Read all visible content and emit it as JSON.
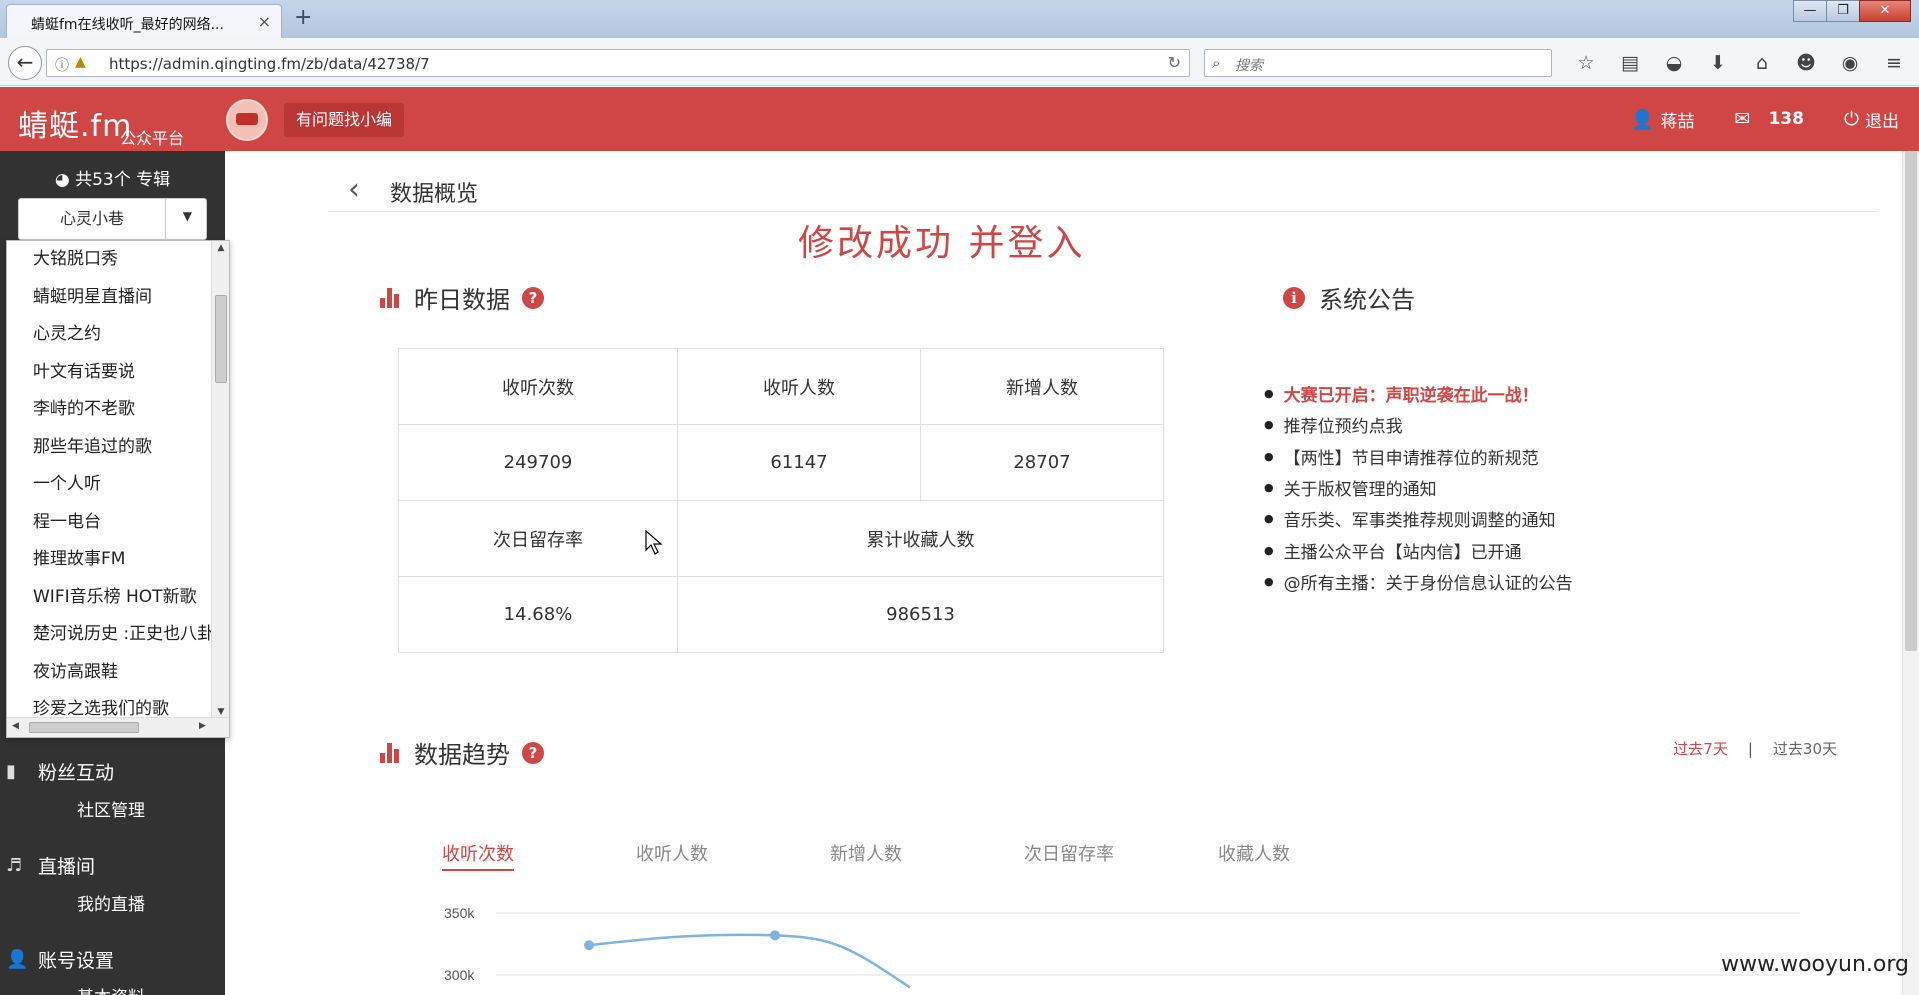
{
  "browser": {
    "tab_title": "蜻蜓fm在线收听_最好的网络...",
    "tab_close": "×",
    "new_tab": "+",
    "window_buttons": [
      "—",
      "❐",
      "✕"
    ],
    "url": "https://admin.qingting.fm/zb/data/42738/7",
    "search_placeholder": "搜索",
    "toolbar_icons": [
      "star-icon",
      "reading-list-icon",
      "pocket-icon",
      "download-icon",
      "home-icon",
      "chat-icon",
      "profile-icon",
      "menu-icon"
    ]
  },
  "header": {
    "logo": "蜻蜓.fm",
    "logo_sub": "公众平台",
    "helper_button": "有问题找小编",
    "user_name": "蒋喆",
    "message_count": "138",
    "logout": "退出",
    "brand_color": "#d04644"
  },
  "sidebar": {
    "album_count": "共53个 专辑",
    "album_selected": "心灵小巷",
    "album_options": [
      "大铭脱口秀",
      "蜻蜓明星直播间",
      "心灵之约",
      "叶文有话要说",
      "李峙的不老歌",
      "那些年追过的歌",
      "一个人听",
      "程一电台",
      "推理故事FM",
      "WIFI音乐榜 HOT新歌",
      "楚河说历史 :正史也八卦",
      "夜访高跟鞋",
      "珍爱之选我们的歌"
    ],
    "sections": [
      {
        "label": "粉丝互动",
        "icon": "comment-icon",
        "sub": "社区管理"
      },
      {
        "label": "直播间",
        "icon": "headphones-icon",
        "sub": "我的直播"
      },
      {
        "label": "账号设置",
        "icon": "user-icon",
        "sub": "基本资料"
      }
    ]
  },
  "main": {
    "page_title": "数据概览",
    "success_message": "修改成功  并登入",
    "yesterday": {
      "title": "昨日数据",
      "headers_row1": [
        "收听次数",
        "收听人数",
        "新增人数"
      ],
      "values_row1": [
        "249709",
        "61147",
        "28707"
      ],
      "headers_row2": [
        "次日留存率",
        "累计收藏人数"
      ],
      "values_row2": [
        "14.68%",
        "986513"
      ]
    },
    "announcements": {
      "title": "系统公告",
      "items": [
        {
          "text": "大赛已开启：声职逆袭在此一战！",
          "hot": true
        },
        {
          "text": "推荐位预约点我",
          "hot": false
        },
        {
          "text": "【两性】节目申请推荐位的新规范",
          "hot": false
        },
        {
          "text": "关于版权管理的通知",
          "hot": false
        },
        {
          "text": "音乐类、军事类推荐规则调整的通知",
          "hot": false
        },
        {
          "text": "主播公众平台【站内信】已开通",
          "hot": false
        },
        {
          "text": "@所有主播：关于身份信息认证的公告",
          "hot": false
        }
      ]
    },
    "trend": {
      "title": "数据趋势",
      "range_active": "过去7天",
      "range_separator": "|",
      "range_other": "过去30天",
      "tabs": [
        "收听次数",
        "收听人数",
        "新增人数",
        "次日留存率",
        "收藏人数"
      ],
      "active_tab": 0
    }
  },
  "chart_data": {
    "type": "line",
    "y_tick_labels": [
      "350k",
      "300k"
    ],
    "series": [
      {
        "values": [
          324000,
          332000,
          290000
        ]
      }
    ],
    "line_color": "#7fb3e0",
    "grid": true
  },
  "watermark": "www.wooyun.org"
}
